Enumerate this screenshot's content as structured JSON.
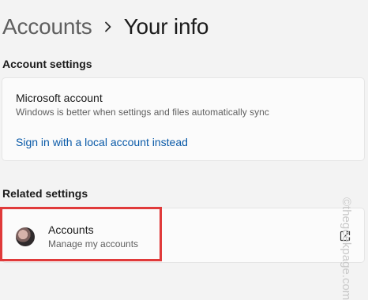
{
  "breadcrumb": {
    "parent": "Accounts",
    "current": "Your info"
  },
  "account_settings": {
    "title": "Account settings",
    "microsoft_account": {
      "title": "Microsoft account",
      "description": "Windows is better when settings and files automatically sync",
      "link": "Sign in with a local account instead"
    }
  },
  "related_settings": {
    "title": "Related settings",
    "accounts_item": {
      "title": "Accounts",
      "description": "Manage my accounts",
      "icon": "external-link-icon"
    }
  },
  "annotation": {
    "color": "#e03a3a"
  },
  "watermark": "©thegeekpage.com",
  "colors": {
    "link": "#0a5aa8",
    "background": "#f3f3f3",
    "card": "#fbfbfb"
  }
}
